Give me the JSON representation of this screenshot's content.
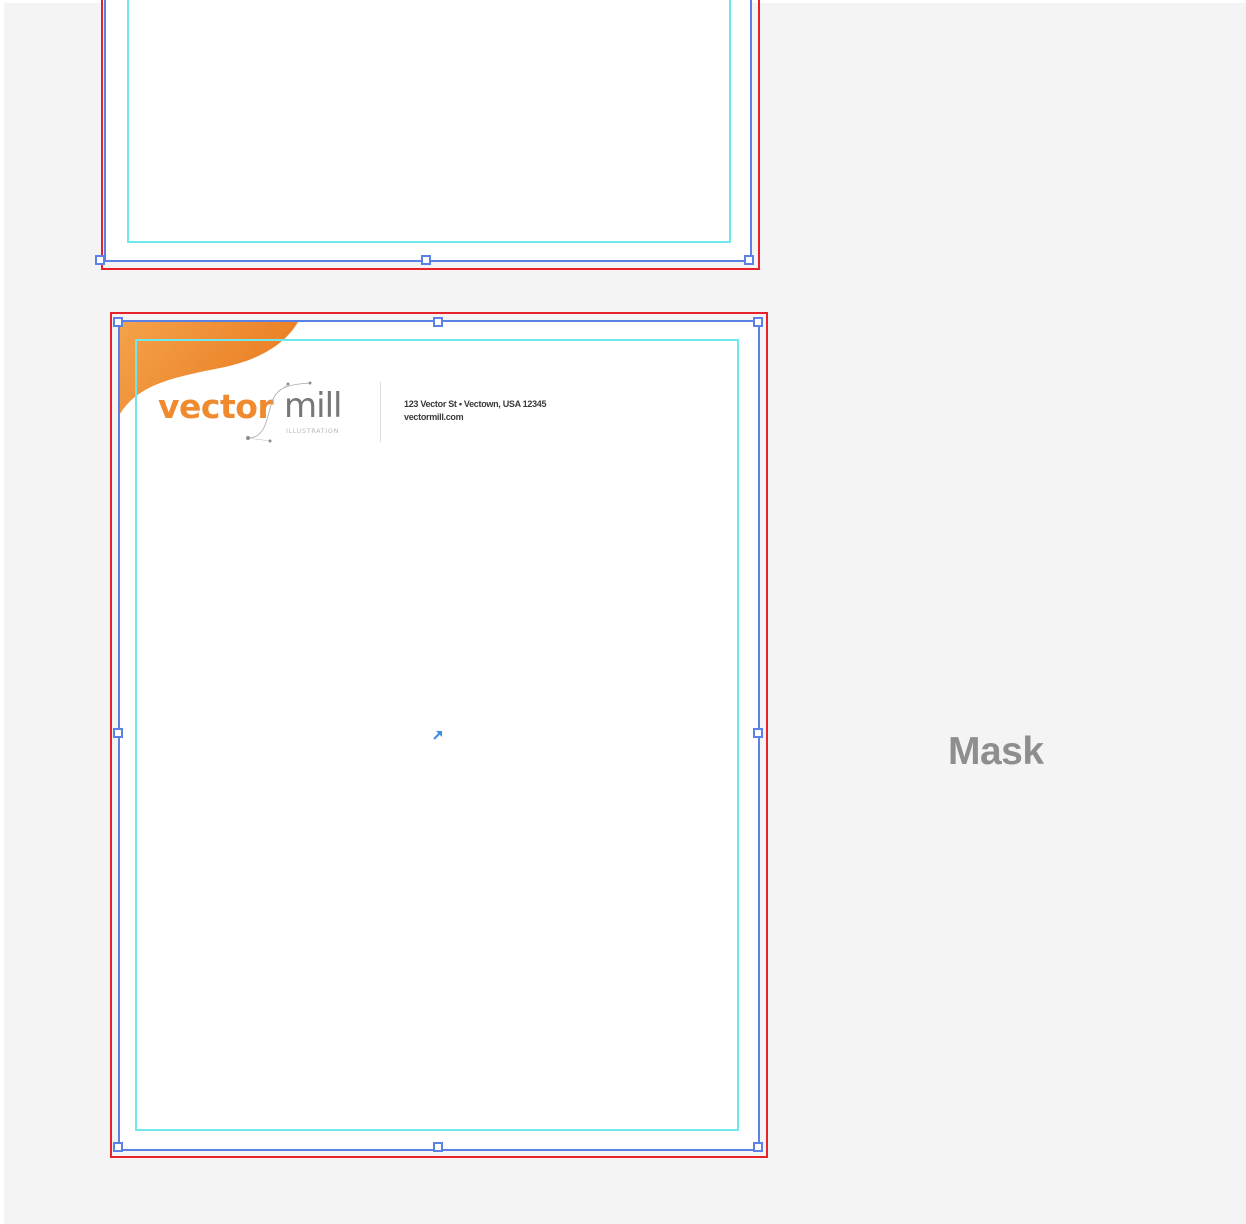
{
  "letterhead": {
    "logo_vector": "vector",
    "logo_mill": "mill",
    "logo_tagline": "ILLUSTRATION",
    "address_line": "123 Vector St • Vectown, USA 12345",
    "website": "vectormill.com"
  },
  "annotation": {
    "label": "Mask"
  },
  "colors": {
    "canvas": "#f4f4f4",
    "bleed_guide": "#e8222b",
    "selection": "#5b80e6",
    "margin_guide": "#6ee8ec",
    "brand_orange": "#ef8a2e",
    "brand_gray": "#777777"
  }
}
